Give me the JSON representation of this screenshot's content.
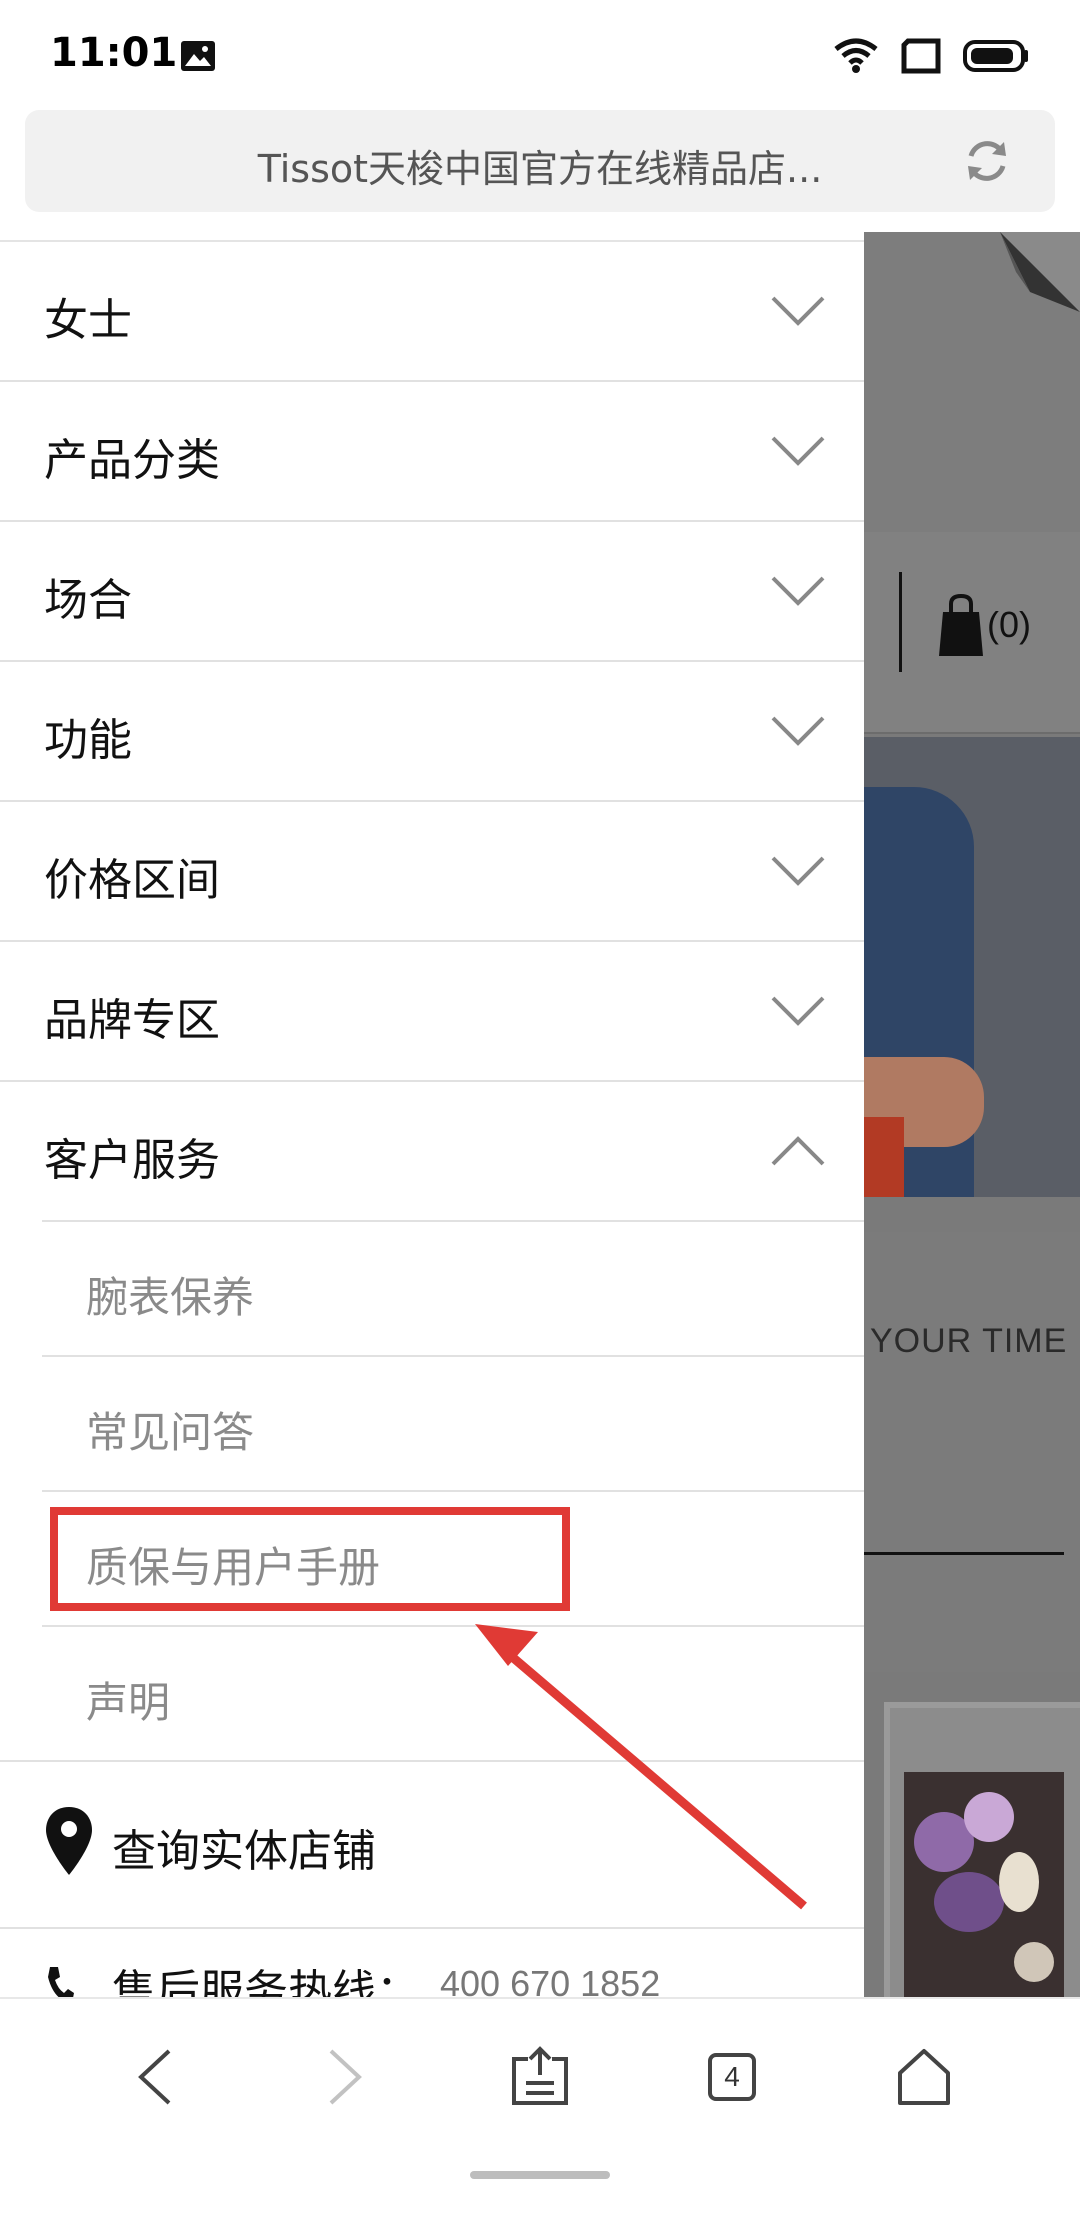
{
  "status_bar": {
    "time": "11:01",
    "icons": [
      "photo-icon",
      "wifi-icon",
      "screen-rotation-icon",
      "battery-icon"
    ]
  },
  "url_bar": {
    "title": "Tissot天梭中国官方在线精品店..."
  },
  "background_page": {
    "cart_count": "(0)",
    "tagline": "YOUR TIME"
  },
  "drawer": {
    "menu": [
      {
        "label": "女士",
        "state": "collapsed"
      },
      {
        "label": "产品分类",
        "state": "collapsed"
      },
      {
        "label": "场合",
        "state": "collapsed"
      },
      {
        "label": "功能",
        "state": "collapsed"
      },
      {
        "label": "价格区间",
        "state": "collapsed"
      },
      {
        "label": "品牌专区",
        "state": "collapsed"
      },
      {
        "label": "客户服务",
        "state": "expanded"
      }
    ],
    "customer_service_items": [
      {
        "label": "腕表保养"
      },
      {
        "label": "常见问答"
      },
      {
        "label": "质保与用户手册"
      },
      {
        "label": "声明"
      }
    ],
    "store_locator": "查询实体店铺",
    "hotline_label": "售后服务热线：",
    "hotline_number": "400 670 1852"
  },
  "annotation": {
    "highlight_color": "#e03a35"
  },
  "bottom_bar": {
    "tab_count": "4",
    "icons": [
      "back-icon",
      "forward-icon",
      "share-icon",
      "tabs-icon",
      "home-icon"
    ]
  }
}
